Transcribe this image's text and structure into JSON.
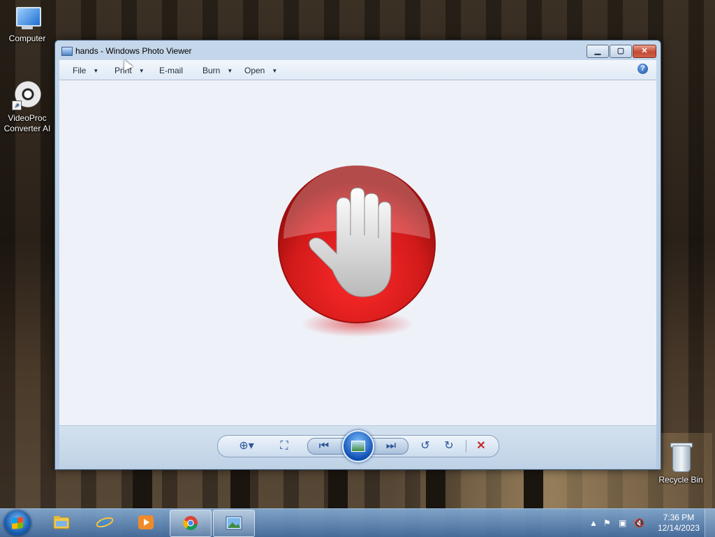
{
  "desktop": {
    "icons": [
      {
        "label": "Computer"
      },
      {
        "label": "VideoProc\nConverter AI"
      },
      {
        "label": "Recycle Bin"
      }
    ]
  },
  "window": {
    "title": "hands - Windows Photo Viewer",
    "caption": {
      "minimize": "▁",
      "maximize": "▢",
      "close": "✕"
    },
    "menu": [
      {
        "label": "File",
        "has_dropdown": true
      },
      {
        "label": "Print",
        "has_dropdown": true
      },
      {
        "label": "E-mail",
        "has_dropdown": false
      },
      {
        "label": "Burn",
        "has_dropdown": true
      },
      {
        "label": "Open",
        "has_dropdown": true
      }
    ],
    "help": "?",
    "image": {
      "name": "hands",
      "icon": "stop-hand-icon",
      "color": "#d21a1a"
    },
    "controls": {
      "zoom": "zoom-icon",
      "actual_size": "actual-size-icon",
      "previous": "previous-icon",
      "slideshow": "slideshow-icon",
      "next": "next-icon",
      "rotate_ccw": "rotate-counterclockwise-icon",
      "rotate_cw": "rotate-clockwise-icon",
      "delete": "delete-icon"
    }
  },
  "taskbar": {
    "pinned": [
      "windows-explorer-icon",
      "internet-explorer-icon",
      "media-player-icon",
      "chrome-icon",
      "photo-viewer-icon"
    ],
    "active": "photo-viewer-icon",
    "clock": {
      "time": "7:36 PM",
      "date": "12/14/2023"
    }
  },
  "colors": {
    "accent": "#2c5597",
    "close": "#c44a32",
    "delete": "#c8262a"
  }
}
